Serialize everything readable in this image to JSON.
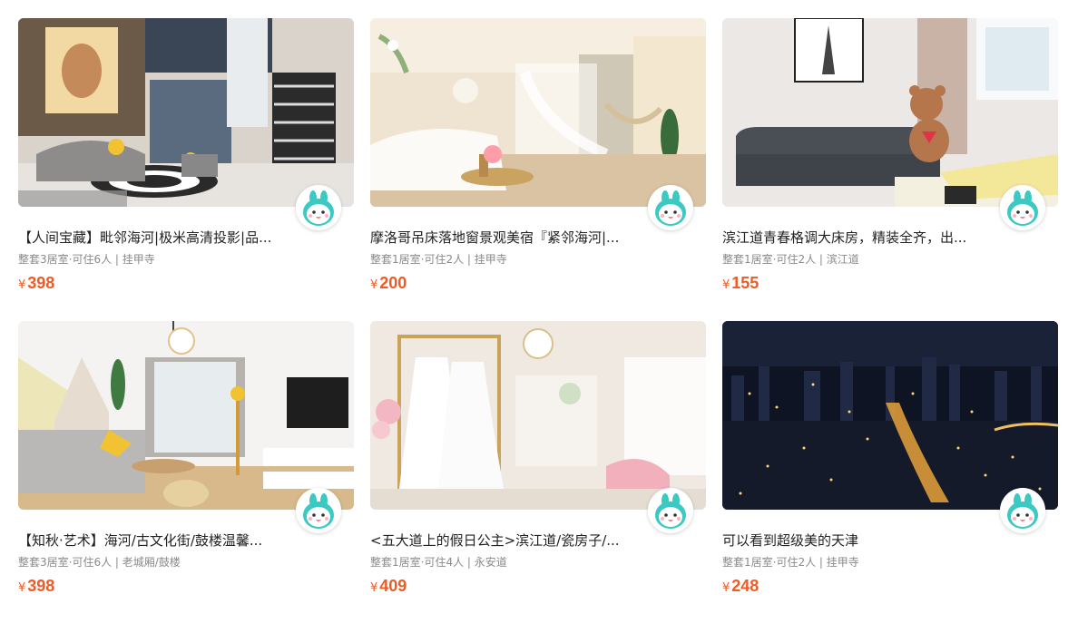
{
  "listings": [
    {
      "title": "【人间宝藏】毗邻海河|极米高清投影|品...",
      "meta": "整套3居室·可住6人 | 挂甲寺",
      "currency": "¥",
      "price": "398",
      "photo": "loft-living-room-photo"
    },
    {
      "title": "摩洛哥吊床落地窗景观美宿『紧邻海河|...",
      "meta": "整套1居室·可住2人 | 挂甲寺",
      "currency": "¥",
      "price": "200",
      "photo": "hammock-bedroom-photo"
    },
    {
      "title": "滨江道青春格调大床房，精装全齐，出...",
      "meta": "整套1居室·可住2人 | 滨江道",
      "currency": "¥",
      "price": "155",
      "photo": "sofa-teddy-bear-photo"
    },
    {
      "title": "【知秋·艺术】海河/古文化街/鼓楼温馨...",
      "meta": "整套3居室·可住6人 | 老城厢/鼓楼",
      "currency": "¥",
      "price": "398",
      "photo": "bright-living-room-photo"
    },
    {
      "title": "<五大道上的假日公主>滨江道/瓷房子/...",
      "meta": "整套1居室·可住4人 | 永安道",
      "currency": "¥",
      "price": "409",
      "photo": "wedding-dress-room-photo"
    },
    {
      "title": "可以看到超级美的天津",
      "meta": "整套1居室·可住2人 | 挂甲寺",
      "currency": "¥",
      "price": "248",
      "photo": "city-night-view-photo"
    }
  ],
  "colors": {
    "price": "#f05a24",
    "avatar": "#3cc9c3"
  },
  "icons": {
    "host_avatar": "host-mascot-icon"
  }
}
